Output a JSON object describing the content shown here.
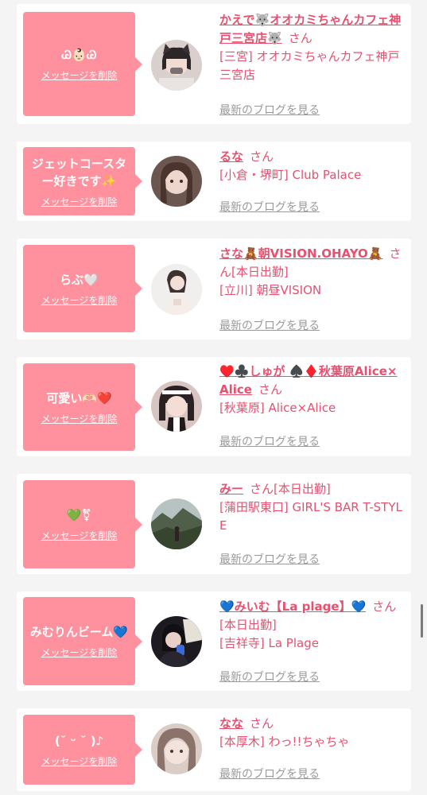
{
  "delete_label": "メッセージを削除",
  "blog_label": "最新のブログを見る",
  "honorific": "さん",
  "colors": {
    "accent": "#e8506f",
    "bubble": "#ff909d",
    "link_gray": "#9a9a9a"
  },
  "items": [
    {
      "message": "Ꮚ👶🏻Ꮚ",
      "name": "かえで🐺オオカミちゃんカフェ神戸三宮店🐺",
      "status": "",
      "shop": "[三宮] オオカミちゃんカフェ神戸三宮店"
    },
    {
      "message": "ジェットコースター好きです✨",
      "name": "るな",
      "status": "",
      "shop": "[小倉・堺町] Club Palace"
    },
    {
      "message": "らぶ🤍",
      "name": "さな🧸朝VISION.OHAYO🧸",
      "status": "[本日出勤]",
      "shop": "[立川] 朝昼VISION"
    },
    {
      "message": "可愛い🫶🏻❤️",
      "name": "♥️♣️しゅが ♠️♦️秋葉原Alice×Alice",
      "status": "",
      "shop": "[秋葉原] Alice×Alice"
    },
    {
      "message": "💚⚧",
      "name": "みー",
      "status": "[本日出勤]",
      "shop": "[蒲田駅東口] GIRL'S BAR T-STYLE"
    },
    {
      "message": "みむりんビーム💙",
      "name": "💙みいむ【La plage】💙",
      "status": "[本日出勤]",
      "shop": "[吉祥寺] La Plage"
    },
    {
      "message": "(˘ ᵕ ˘ )♪",
      "name": "なな",
      "status": "",
      "shop": "[本厚木] わっ!!ちゃちゃ"
    }
  ]
}
